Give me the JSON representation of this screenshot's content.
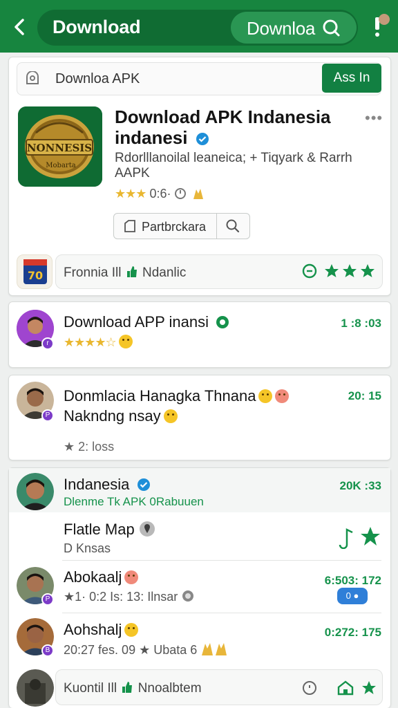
{
  "header": {
    "title": "Download",
    "search_text": "Downloa",
    "colors": {
      "bar": "#17853f",
      "accent": "#128042"
    }
  },
  "app_card": {
    "search_text": "Downloa APK",
    "assign_button": "Ass In",
    "app_icon_text": "NONNESIS",
    "app_icon_subtext": "Mobarta",
    "title": "Download APK Indanesia indanesi",
    "subtitle": "Rdorlllanoilal leaneica; + Tiqyark & Rarrh AAPK",
    "rating_text": "0:6·",
    "action_label": "Partbrckara",
    "badge_text": "70",
    "inner_text_a": "Fronnia Ill",
    "inner_text_b": "Ndanlic"
  },
  "posts": [
    {
      "name": "Download APP inansi",
      "time": "1 :8 :03",
      "meta": "★★★★☆"
    },
    {
      "name": "Donmlacia Hanagka Thnana",
      "line2": "Nakndng nsay",
      "time": "20: 15",
      "meta": "★ 2: loss"
    }
  ],
  "thread": {
    "name": "Indanesia",
    "time": "20K :33",
    "sub": "Dlenme Tk APK 0Rabuuen",
    "items": [
      {
        "name": "Flatle Map",
        "sub": "D Knsas"
      },
      {
        "name": "Abokaalj",
        "sub": "★1· 0:2 Is: 13: Ilnsar",
        "time": "6:503: 172",
        "pill": "0"
      },
      {
        "name": "Aohshalj",
        "sub": "20:27 fes. 09 ★ Ubata 6",
        "time": "0:272: 175"
      }
    ],
    "bottom_text_a": "Kuontil Ill",
    "bottom_text_b": "Nnoalbtem"
  }
}
